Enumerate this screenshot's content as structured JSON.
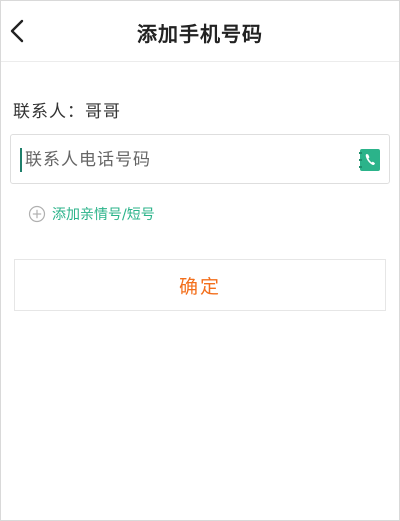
{
  "header": {
    "title": "添加手机号码",
    "back_icon": "chevron-left-icon"
  },
  "contact": {
    "label": "联系人：哥哥"
  },
  "phone_field": {
    "placeholder": "联系人电话号码",
    "value": "",
    "icon": "phone-book-icon",
    "icon_color": "#2bb38a"
  },
  "add_link": {
    "icon": "plus-circle-icon",
    "label": "添加亲情号/短号"
  },
  "confirm_button": {
    "label": "确定",
    "color": "#f36f1c"
  }
}
